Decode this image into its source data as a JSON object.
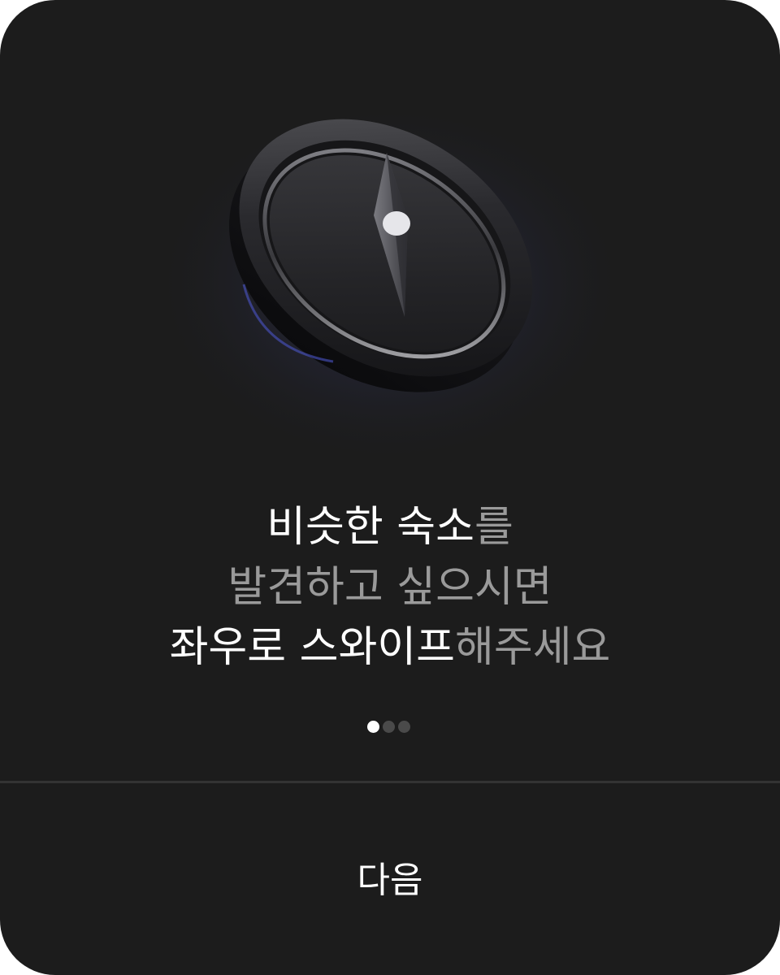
{
  "onboarding": {
    "headline": {
      "line1_highlight": "비슷한 숙소",
      "line1_rest": "를",
      "line2": "발견하고 싶으시면",
      "line3_highlight": "좌우로 스와이프",
      "line3_rest": "해주세요"
    },
    "page_indicator": {
      "current": 1,
      "total": 3
    },
    "next_button_label": "다음"
  },
  "illustration": {
    "icon": "compass-icon"
  },
  "colors": {
    "background": "#1c1c1c",
    "text_primary": "#ffffff",
    "text_muted": "#9a9a9a",
    "dot_inactive": "#4a4a4a",
    "divider": "#333333"
  }
}
